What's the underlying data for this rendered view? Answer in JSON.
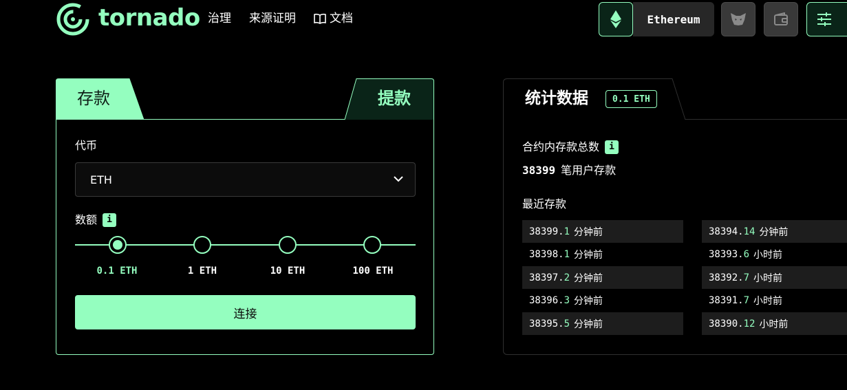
{
  "header": {
    "brand": "tornado",
    "nav": [
      {
        "label": "治理"
      },
      {
        "label": "来源证明"
      },
      {
        "label": "文档",
        "icon": "book-icon"
      }
    ],
    "network": "Ethereum",
    "colors": {
      "accent": "#94febf",
      "background": "#000000"
    }
  },
  "deposit_card": {
    "tabs": {
      "deposit": "存款",
      "withdraw": "提款"
    },
    "token_label": "代币",
    "token_value": "ETH",
    "amount_label": "数额",
    "info_badge": "i",
    "amounts": [
      "0.1 ETH",
      "1 ETH",
      "10 ETH",
      "100 ETH"
    ],
    "selected_amount": "0.1 ETH",
    "connect_label": "连接"
  },
  "stats_card": {
    "title": "统计数据",
    "badge": "0.1 ETH",
    "total_label": "合约内存款总数",
    "info_badge": "i",
    "total_count": "38399",
    "total_suffix": "笔用户存款",
    "recent_label": "最近存款",
    "recent_left": [
      {
        "id": "38399.",
        "time": "1",
        "unit": "分钟前"
      },
      {
        "id": "38398.",
        "time": "1",
        "unit": "分钟前"
      },
      {
        "id": "38397.",
        "time": "2",
        "unit": "分钟前"
      },
      {
        "id": "38396.",
        "time": "3",
        "unit": "分钟前"
      },
      {
        "id": "38395.",
        "time": "5",
        "unit": "分钟前"
      }
    ],
    "recent_right": [
      {
        "id": "38394.",
        "time": "14",
        "unit": "分钟前"
      },
      {
        "id": "38393.",
        "time": "6",
        "unit": "小时前"
      },
      {
        "id": "38392.",
        "time": "7",
        "unit": "小时前"
      },
      {
        "id": "38391.",
        "time": "7",
        "unit": "小时前"
      },
      {
        "id": "38390.",
        "time": "12",
        "unit": "小时前"
      }
    ]
  }
}
